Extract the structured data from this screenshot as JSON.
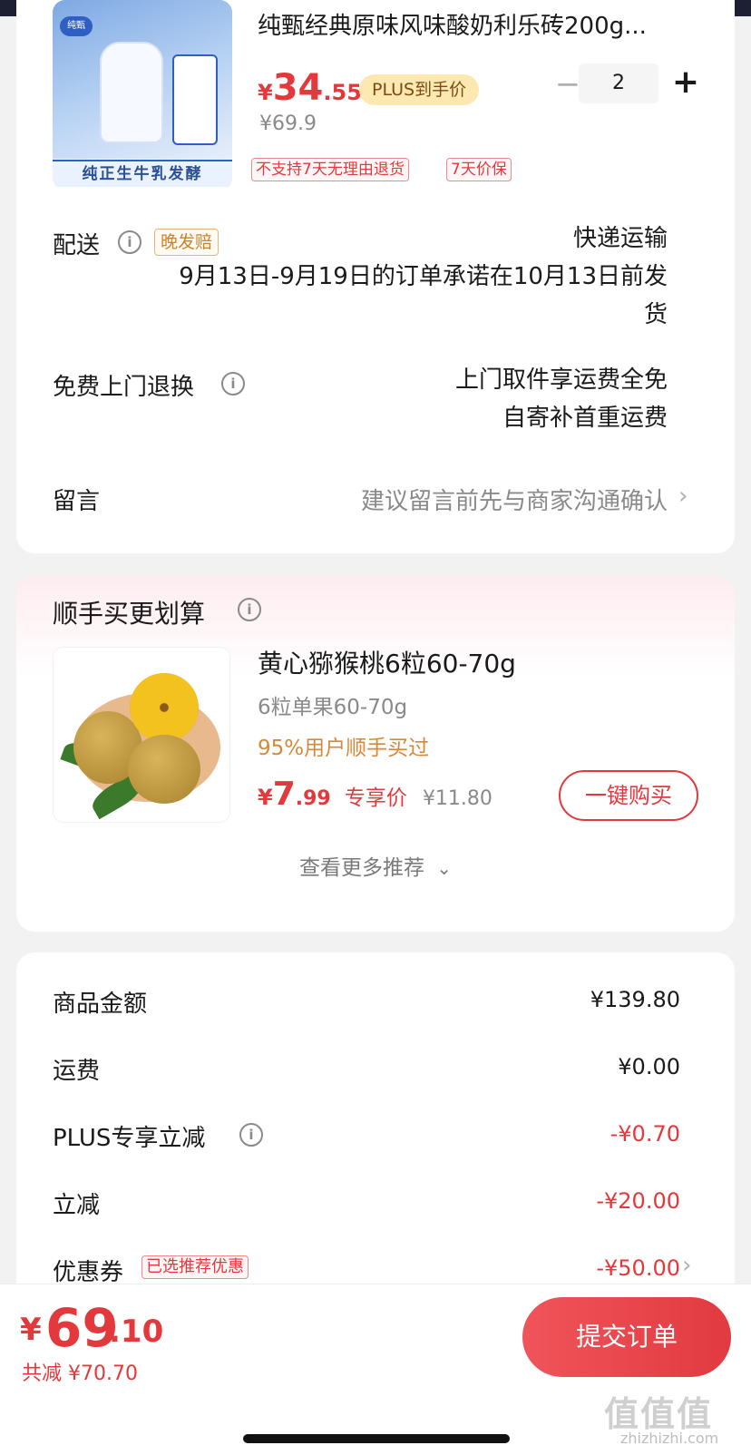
{
  "product": {
    "title": "纯甄经典原味风味酸奶利乐砖200g...",
    "image_label": "纯正生牛乳发酵",
    "brand_logo": "纯甄",
    "price_symbol": "¥",
    "price_int": "34",
    "price_dec": ".55",
    "plus_badge": "PLUS到手价",
    "original_price": "¥69.9",
    "tags": [
      "不支持7天无理由退货",
      "7天价保"
    ],
    "quantity": "2",
    "minus": "−",
    "plus": "+"
  },
  "delivery": {
    "label": "配送",
    "tag": "晚发赔",
    "method": "快递运输",
    "promise_line1": "9月13日-9月19日的订单承诺在10月13日前发",
    "promise_line2": "货"
  },
  "returns": {
    "label": "免费上门退换",
    "line1": "上门取件享运费全免",
    "line2": "自寄补首重运费"
  },
  "message": {
    "label": "留言",
    "placeholder": "建议留言前先与商家沟通确认"
  },
  "recommend": {
    "title": "顺手买更划算",
    "item_title": "黄心猕猴桃6粒60-70g",
    "item_sub": "6粒单果60-70g",
    "item_bought": "95%用户顺手买过",
    "price_symbol": "¥",
    "price_int": "7",
    "price_dec": ".99",
    "price_label": "专享价",
    "price_orig": "¥11.80",
    "buy_button": "一键购买",
    "more": "查看更多推荐"
  },
  "summary": {
    "rows": [
      {
        "label": "商品金额",
        "value": "¥139.80",
        "red": false
      },
      {
        "label": "运费",
        "value": "¥0.00",
        "red": false
      },
      {
        "label": "PLUS专享立减",
        "value": "-¥0.70",
        "red": true
      },
      {
        "label": "立减",
        "value": "-¥20.00",
        "red": true
      },
      {
        "label": "优惠券",
        "value": "-¥50.00",
        "red": true
      }
    ],
    "coupon_tag": "已选推荐优惠"
  },
  "bottom": {
    "total_symbol": "¥",
    "total_int": "69",
    "total_dec": ".10",
    "saved": "共减 ¥70.70",
    "submit": "提交订单"
  },
  "watermark": {
    "main": "值值值",
    "sub": "zhizhizhi.com"
  },
  "colors": {
    "accent_red": "#e4393c",
    "plus_gold": "#fce8b0",
    "orange_text": "#d48a3a"
  }
}
